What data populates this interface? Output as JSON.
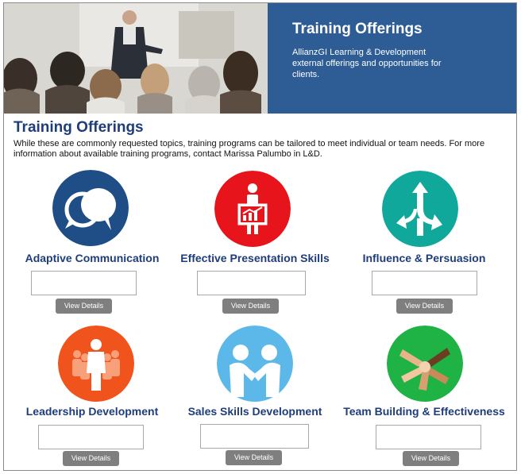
{
  "banner": {
    "title": "Training Offerings",
    "description": "AllianzGI Learning & Development external offerings and opportunities for clients.",
    "panel_color": "#2e5d96"
  },
  "page": {
    "title": "Training Offerings",
    "intro": "While these are commonly requested topics, training programs can be tailored to meet individual or team needs. For more information about available training programs, contact Marissa Palumbo in L&D."
  },
  "offerings": [
    {
      "title": "Adaptive Communication",
      "icon": "speech-bubbles-icon",
      "color": "#1f4d86",
      "button": "View Details"
    },
    {
      "title": "Effective Presentation Skills",
      "icon": "presenter-chart-icon",
      "color": "#e8141c",
      "button": "View Details"
    },
    {
      "title": "Influence & Persuasion",
      "icon": "diverging-arrows-icon",
      "color": "#10a89a",
      "button": "View Details"
    },
    {
      "title": "Leadership Development",
      "icon": "leader-group-icon",
      "color": "#f0531c",
      "button": "View Details"
    },
    {
      "title": "Sales Skills Development",
      "icon": "handshake-icon",
      "color": "#5bb8e8",
      "button": "View Details"
    },
    {
      "title": "Team Building & Effectiveness",
      "icon": "joined-hands-icon",
      "color": "#1fb245",
      "button": "View Details"
    }
  ]
}
